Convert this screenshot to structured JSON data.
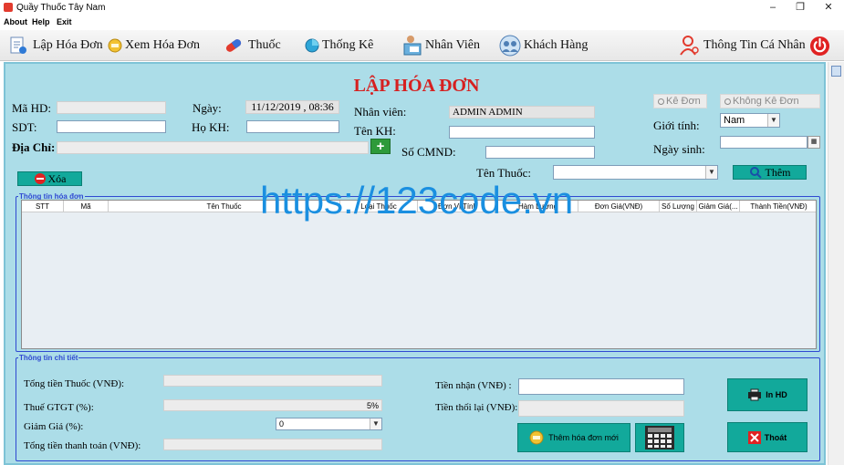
{
  "window": {
    "title": "Quầy Thuốc Tây Nam",
    "minimize": "–",
    "maximize": "❐",
    "close": "✕"
  },
  "menu": [
    "About",
    "Help",
    "Exit"
  ],
  "toolbar": {
    "lap_hoa_don": "Lập Hóa Đơn",
    "xem_hoa_don": "Xem Hóa Đơn",
    "thuoc": "Thuốc",
    "thong_ke": "Thống Kê",
    "nhan_vien": "Nhân Viên",
    "khach_hang": "Khách Hàng",
    "thong_tin": "Thông Tin Cá Nhân"
  },
  "form": {
    "title": "LẬP HÓA ĐƠN",
    "ma_hd_label": "Mã HD:",
    "ngay_label": "Ngày:",
    "ngay_value": "11/12/2019 , 08:36",
    "sdt_label": "SDT:",
    "ho_kh_label": "Họ KH:",
    "dia_chi_label": "Địa Chỉ:",
    "nhan_vien_label": "Nhân viên:",
    "nhan_vien_value": "ADMIN ADMIN",
    "ten_kh_label": "Tên KH:",
    "so_cmnd_label": "Số CMND:",
    "ke_don": "Kê Đơn",
    "khong_ke_don": "Không Kê Đơn",
    "gioi_tinh_label": "Giới tính:",
    "gioi_tinh_value": "Nam",
    "ngay_sinh_label": "Ngày sinh:",
    "xoa": "Xóa",
    "ten_thuoc_label": "Tên Thuốc:",
    "them": "Thêm"
  },
  "invoice_grid": {
    "legend": "Thông tin hóa đơn",
    "columns": [
      "STT",
      "Mã",
      "Tên Thuốc",
      "Loại Thuốc",
      "Đơn Vị Tính",
      "Hàm Lượng",
      "Đơn Giá(VNĐ)",
      "Số Lượng",
      "Giảm Giá(...",
      "Thành Tiền(VNĐ)"
    ]
  },
  "details": {
    "legend": "Thông tin chi tiết",
    "tong_tien_thuoc": "Tổng tiền Thuốc (VNĐ):",
    "thue_gtgt": "Thuế GTGT (%):",
    "thue_value": "5%",
    "giam_gia": "Giảm Giá (%):",
    "giam_gia_value": "0",
    "tong_thanh_toan": "Tổng tiền thanh toán (VNĐ):",
    "tien_nhan": "Tiền nhận (VNĐ) :",
    "tien_thoi": "Tiền thối lại (VNĐ):",
    "them_hoa_don_moi": "Thêm hóa đơn mới",
    "in_hd": "In HD",
    "thoat": "Thoát"
  },
  "watermark": "https://123code.vn",
  "colors": {
    "panel": "#acdde8",
    "title_red": "#d62020",
    "button_teal": "#12a99b",
    "group_border": "#2f49d1"
  }
}
